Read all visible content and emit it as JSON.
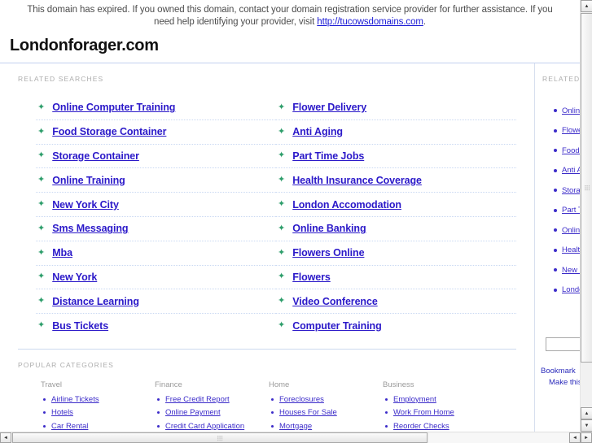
{
  "banner": {
    "text_part1": "This domain has expired. If you owned this domain, contact your domain registration service provider for further assistance. If you need help identifying your provider, visit ",
    "link_text": "http://tucowsdomains.com",
    "text_part2": ".",
    "link_color": "#1a1ad6"
  },
  "header": {
    "domain_title": "Londonforager.com"
  },
  "main": {
    "related_searches_heading": "RELATED SEARCHES",
    "left_links": [
      "Online Computer Training",
      "Food Storage Container",
      "Storage Container",
      "Online Training",
      "New York City",
      "Sms Messaging",
      "Mba",
      "New York",
      "Distance Learning",
      "Bus Tickets"
    ],
    "right_links": [
      "Flower Delivery",
      "Anti Aging",
      "Part Time Jobs",
      "Health Insurance Coverage",
      "London Accomodation",
      "Online Banking",
      "Flowers Online",
      "Flowers",
      "Video Conference",
      "Computer Training"
    ],
    "bullet_icon": "sparkle-icon",
    "bullet_color": "#2e9e6b",
    "link_color": "#2b19c9"
  },
  "popular_categories": {
    "heading": "POPULAR CATEGORIES",
    "columns": [
      {
        "title": "Travel",
        "items": [
          "Airline Tickets",
          "Hotels",
          "Car Rental"
        ]
      },
      {
        "title": "Finance",
        "items": [
          "Free Credit Report",
          "Online Payment",
          "Credit Card Application"
        ]
      },
      {
        "title": "Home",
        "items": [
          "Foreclosures",
          "Houses For Sale",
          "Mortgage"
        ]
      },
      {
        "title": "Business",
        "items": [
          "Employment",
          "Work From Home",
          "Reorder Checks"
        ]
      }
    ]
  },
  "sidebar": {
    "heading": "RELATED",
    "items": [
      "Online Computer Training",
      "Flower Delivery",
      "Food Storage Container",
      "Anti Aging",
      "Storage Container",
      "Part Time Jobs",
      "Online Training",
      "Health Insurance Coverage",
      "New York City",
      "London Accomodation"
    ],
    "search_value": "",
    "search_placeholder": "",
    "footer_line1": "Bookmark",
    "footer_line2": "Make this"
  },
  "scrollbars": {
    "v_up_arrow": "▲",
    "v_down_arrow": "▼",
    "h_left_arrow": "◄",
    "h_right_arrow": "►"
  }
}
